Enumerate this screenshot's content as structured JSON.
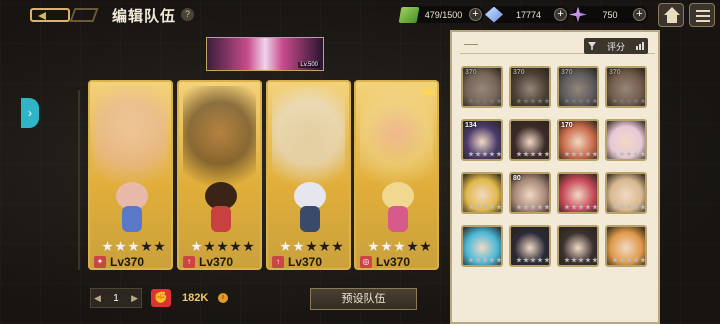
{
  "header": {
    "title": "编辑队伍",
    "help": "?"
  },
  "resources": {
    "energy": "479/1500",
    "crystal": "17774",
    "gem": "750",
    "plus": "+"
  },
  "banner": {
    "level": "Lv.500"
  },
  "side_tab": {
    "arrow": "›"
  },
  "heroes": [
    {
      "level": "Lv370",
      "stars": 3,
      "class_icon": "✦",
      "accent": "#f2c8c8",
      "hair": "#e8b8a8",
      "outfit": "#5a78c8"
    },
    {
      "level": "Lv370",
      "stars": 1,
      "class_icon": "↑",
      "accent": "#8a4e2a",
      "hair": "#3a2418",
      "outfit": "#c84040"
    },
    {
      "level": "Lv370",
      "stars": 2,
      "class_icon": "↑",
      "accent": "#dcdcdc",
      "hair": "#e6e6ee",
      "outfit": "#3a4a6a"
    },
    {
      "level": "Lv370",
      "stars": 3,
      "class_icon": "◎",
      "accent": "#f3b0b8",
      "hair": "#f0d890",
      "outfit": "#d85a8a"
    }
  ],
  "bottom": {
    "team_number": "1",
    "prev": "◀",
    "next": "▶",
    "power_icon": "✊",
    "power": "182K",
    "power_info": "i",
    "preset_label": "预设队伍"
  },
  "roster": {
    "sort_label": "评分",
    "tiles": [
      {
        "level": "370",
        "color": "#b89a8a",
        "dim": true
      },
      {
        "level": "370",
        "color": "#6e5a4a",
        "dim": true
      },
      {
        "level": "370",
        "color": "#8a8a94",
        "dim": true
      },
      {
        "level": "370",
        "color": "#b08a72",
        "dim": true
      },
      {
        "level": "134",
        "color": "#4a3a6a",
        "dim": false
      },
      {
        "level": "",
        "color": "#3c2a2a",
        "dim": false
      },
      {
        "level": "170",
        "color": "#c86a4a",
        "dim": false
      },
      {
        "level": "",
        "color": "#e8c8d8",
        "dim": false
      },
      {
        "level": "",
        "color": "#e0b84a",
        "dim": false
      },
      {
        "level": "80",
        "color": "#a88878",
        "dim": false
      },
      {
        "level": "",
        "color": "#c84a5a",
        "dim": false
      },
      {
        "level": "",
        "color": "#d8b890",
        "dim": false
      },
      {
        "level": "",
        "color": "#4ab8d8",
        "dim": false
      },
      {
        "level": "",
        "color": "#2a2a38",
        "dim": false
      },
      {
        "level": "",
        "color": "#3a3030",
        "dim": false
      },
      {
        "level": "",
        "color": "#e09a4a",
        "dim": false
      }
    ]
  }
}
